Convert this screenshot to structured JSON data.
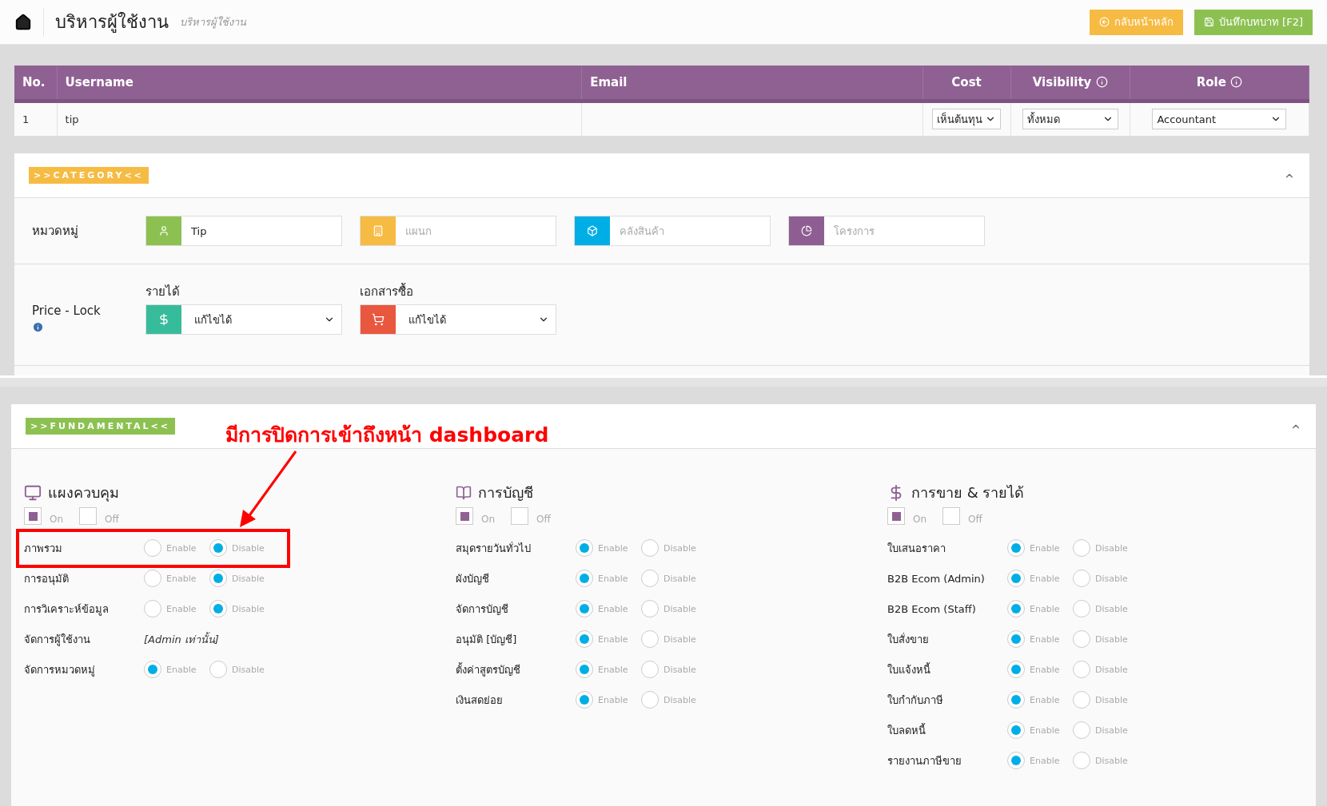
{
  "header": {
    "title": "บริหารผู้ใช้งาน",
    "subtitle": "บริหารผู้ใช้งาน",
    "buttons": [
      {
        "kind": "back",
        "label": "กลับหน้าหลัก"
      },
      {
        "kind": "save",
        "label": "บันทึกบทบาท [F2]"
      }
    ]
  },
  "table": {
    "columns": [
      {
        "label": "No.",
        "info": false
      },
      {
        "label": "Username",
        "info": false
      },
      {
        "label": "Email",
        "info": false
      },
      {
        "label": "Cost",
        "info": false
      },
      {
        "label": "Visibility",
        "info": true
      },
      {
        "label": "Role",
        "info": true
      }
    ],
    "rows": [
      {
        "no": "1",
        "username": "tip",
        "cost": "เห็นต้นทุน",
        "visibility": "ทั้งหมด",
        "role": "Accountant"
      }
    ]
  },
  "category": {
    "tag": ">>CATEGORY<<",
    "label": "หมวดหมู่",
    "fields": [
      {
        "color": "#8cc152",
        "value": "Tip"
      },
      {
        "color": "#f6bb42",
        "placeholder": "แผนก"
      },
      {
        "color": "#00aee6",
        "placeholder": "คลังสินค้า"
      },
      {
        "color": "#8e5e93",
        "placeholder": "โครงการ"
      }
    ],
    "price_lock": {
      "label": "Price - Lock",
      "selects": [
        {
          "label": "รายได้",
          "color": "#37bc9b",
          "value": "แก้ไขได้"
        },
        {
          "label": "เอกสารซื้อ",
          "color": "#e9573f",
          "value": "แก้ไขได้"
        }
      ]
    }
  },
  "fundamental": {
    "tag": ">>FUNDAMENTAL<<",
    "groups": [
      {
        "title": "แผงควบคุม",
        "toggle": [
          {
            "label": "On",
            "selected": true
          },
          {
            "label": "Off",
            "selected": false
          }
        ],
        "items": [
          {
            "kind": "radio",
            "label": "ภาพรวม",
            "options": [
              {
                "label": "Enable",
                "selected": false
              },
              {
                "label": "Disable",
                "selected": true
              }
            ]
          },
          {
            "kind": "radio",
            "label": "การอนุมัติ",
            "options": [
              {
                "label": "Enable",
                "selected": false
              },
              {
                "label": "Disable",
                "selected": true
              }
            ]
          },
          {
            "kind": "radio",
            "label": "การวิเคราะห์ข้อมูล",
            "options": [
              {
                "label": "Enable",
                "selected": false
              },
              {
                "label": "Disable",
                "selected": true
              }
            ]
          },
          {
            "kind": "note",
            "label": "จัดการผู้ใช้งาน",
            "note": "[Admin เท่านั้น]"
          },
          {
            "kind": "radio",
            "label": "จัดการหมวดหมู่",
            "options": [
              {
                "label": "Enable",
                "selected": true
              },
              {
                "label": "Disable",
                "selected": false
              }
            ]
          }
        ]
      },
      {
        "title": "การบัญชี",
        "toggle": [
          {
            "label": "On",
            "selected": true
          },
          {
            "label": "Off",
            "selected": false
          }
        ],
        "items": [
          {
            "kind": "radio",
            "label": "สมุดรายวันทั่วไป",
            "options": [
              {
                "label": "Enable",
                "selected": true
              },
              {
                "label": "Disable",
                "selected": false
              }
            ]
          },
          {
            "kind": "radio",
            "label": "ผังบัญชี",
            "options": [
              {
                "label": "Enable",
                "selected": true
              },
              {
                "label": "Disable",
                "selected": false
              }
            ]
          },
          {
            "kind": "radio",
            "label": "จัดการบัญชี",
            "options": [
              {
                "label": "Enable",
                "selected": true
              },
              {
                "label": "Disable",
                "selected": false
              }
            ]
          },
          {
            "kind": "radio",
            "label": "อนุมัติ [บัญชี]",
            "options": [
              {
                "label": "Enable",
                "selected": true
              },
              {
                "label": "Disable",
                "selected": false
              }
            ]
          },
          {
            "kind": "radio",
            "label": "ตั้งค่าสูตรบัญชี",
            "options": [
              {
                "label": "Enable",
                "selected": true
              },
              {
                "label": "Disable",
                "selected": false
              }
            ]
          },
          {
            "kind": "radio",
            "label": "เงินสดย่อย",
            "options": [
              {
                "label": "Enable",
                "selected": true
              },
              {
                "label": "Disable",
                "selected": false
              }
            ]
          }
        ]
      },
      {
        "title": "การขาย & รายได้",
        "toggle": [
          {
            "label": "On",
            "selected": true
          },
          {
            "label": "Off",
            "selected": false
          }
        ],
        "items": [
          {
            "kind": "radio",
            "label": "ใบเสนอราคา",
            "options": [
              {
                "label": "Enable",
                "selected": true
              },
              {
                "label": "Disable",
                "selected": false
              }
            ]
          },
          {
            "kind": "radio",
            "label": "B2B Ecom (Admin)",
            "options": [
              {
                "label": "Enable",
                "selected": true
              },
              {
                "label": "Disable",
                "selected": false
              }
            ]
          },
          {
            "kind": "radio",
            "label": "B2B Ecom (Staff)",
            "options": [
              {
                "label": "Enable",
                "selected": true
              },
              {
                "label": "Disable",
                "selected": false
              }
            ]
          },
          {
            "kind": "radio",
            "label": "ใบสั่งขาย",
            "options": [
              {
                "label": "Enable",
                "selected": true
              },
              {
                "label": "Disable",
                "selected": false
              }
            ]
          },
          {
            "kind": "radio",
            "label": "ใบแจ้งหนี้",
            "options": [
              {
                "label": "Enable",
                "selected": true
              },
              {
                "label": "Disable",
                "selected": false
              }
            ]
          },
          {
            "kind": "radio",
            "label": "ใบกำกับภาษี",
            "options": [
              {
                "label": "Enable",
                "selected": true
              },
              {
                "label": "Disable",
                "selected": false
              }
            ]
          },
          {
            "kind": "radio",
            "label": "ใบลดหนี้",
            "options": [
              {
                "label": "Enable",
                "selected": true
              },
              {
                "label": "Disable",
                "selected": false
              }
            ]
          },
          {
            "kind": "radio",
            "label": "รายงานภาษีขาย",
            "options": [
              {
                "label": "Enable",
                "selected": true
              },
              {
                "label": "Disable",
                "selected": false
              }
            ]
          }
        ]
      }
    ]
  },
  "annotation": {
    "text": "มีการปิดการเข้าถึงหน้า  dashboard"
  }
}
